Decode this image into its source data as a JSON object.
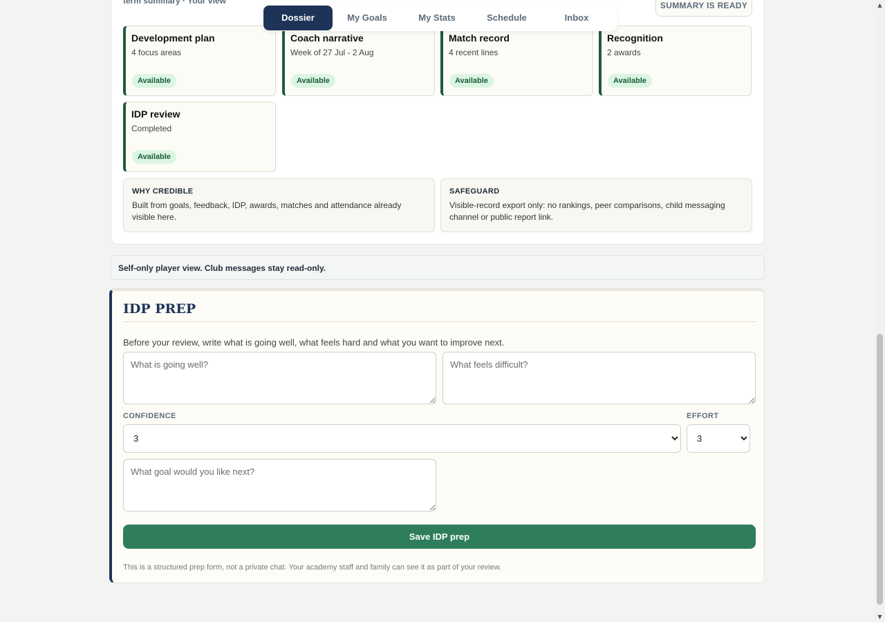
{
  "summary": {
    "caption": "term summary · Your view",
    "ready_badge": "SUMMARY IS READY",
    "cards": [
      {
        "title": "Development plan",
        "sub": "4 focus areas",
        "badge": "Available"
      },
      {
        "title": "Coach narrative",
        "sub": "Week of 27 Jul - 2 Aug",
        "badge": "Available"
      },
      {
        "title": "Match record",
        "sub": "4 recent lines",
        "badge": "Available"
      },
      {
        "title": "Recognition",
        "sub": "2 awards",
        "badge": "Available"
      },
      {
        "title": "IDP review",
        "sub": "Completed",
        "badge": "Available"
      }
    ],
    "why_credible": {
      "title": "WHY CREDIBLE",
      "text": "Built from goals, feedback, IDP, awards, matches and attendance already visible here."
    },
    "safeguard": {
      "title": "SAFEGUARD",
      "text": "Visible-record export only: no rankings, peer comparisons, child messaging channel or public report link."
    }
  },
  "nav": {
    "tabs": [
      {
        "label": "Dossier",
        "active": true
      },
      {
        "label": "My Goals"
      },
      {
        "label": "My Stats"
      },
      {
        "label": "Schedule"
      },
      {
        "label": "Inbox"
      }
    ]
  },
  "notice": "Self-only player view. Club messages stay read-only.",
  "idp": {
    "title": "IDP PREP",
    "intro": "Before your review, write what is going well, what feels hard and what you want to improve next.",
    "going_well_placeholder": "What is going well?",
    "difficult_placeholder": "What feels difficult?",
    "confidence_label": "CONFIDENCE",
    "confidence_value": "3",
    "effort_label": "EFFORT",
    "effort_value": "3",
    "next_goal_placeholder": "What goal would you like next?",
    "save_label": "Save IDP prep",
    "footnote": "This is a structured prep form, not a private chat. Your academy staff and family can see it as part of your review."
  },
  "colors": {
    "navy": "#1e3358",
    "green": "#2e7d5b",
    "badge_bg": "#dcf5e3"
  }
}
